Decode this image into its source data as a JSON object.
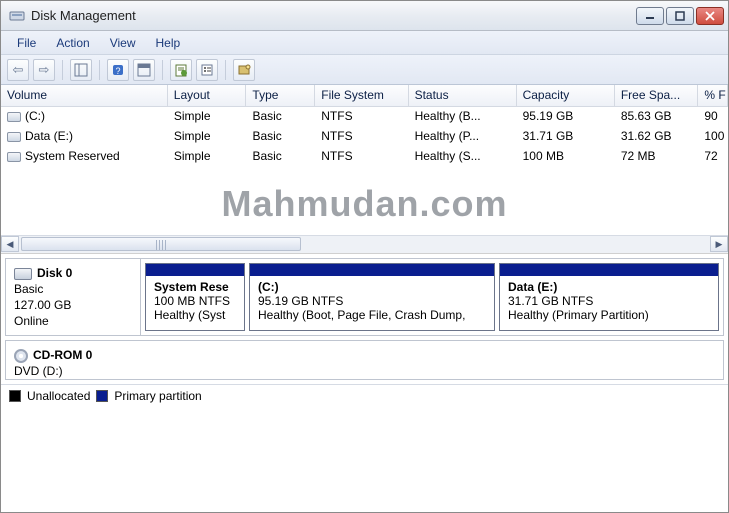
{
  "window": {
    "title": "Disk Management"
  },
  "menu": {
    "file": "File",
    "action": "Action",
    "view": "View",
    "help": "Help"
  },
  "columns": {
    "volume": "Volume",
    "layout": "Layout",
    "type": "Type",
    "fs": "File System",
    "status": "Status",
    "capacity": "Capacity",
    "free": "Free Spa...",
    "pct": "% F"
  },
  "volumes": [
    {
      "name": "(C:)",
      "layout": "Simple",
      "type": "Basic",
      "fs": "NTFS",
      "status": "Healthy (B...",
      "capacity": "95.19 GB",
      "free": "85.63 GB",
      "pct": "90"
    },
    {
      "name": "Data (E:)",
      "layout": "Simple",
      "type": "Basic",
      "fs": "NTFS",
      "status": "Healthy (P...",
      "capacity": "31.71 GB",
      "free": "31.62 GB",
      "pct": "100"
    },
    {
      "name": "System Reserved",
      "layout": "Simple",
      "type": "Basic",
      "fs": "NTFS",
      "status": "Healthy (S...",
      "capacity": "100 MB",
      "free": "72 MB",
      "pct": "72"
    }
  ],
  "watermark": "Mahmudan.com",
  "disk0": {
    "name": "Disk 0",
    "type": "Basic",
    "size": "127.00 GB",
    "state": "Online",
    "partitions": {
      "sr": {
        "name": "System Rese",
        "size": "100 MB NTFS",
        "status": "Healthy (Syst"
      },
      "c": {
        "name": "(C:)",
        "size": "95.19 GB NTFS",
        "status": "Healthy (Boot, Page File, Crash Dump,"
      },
      "e": {
        "name": "Data  (E:)",
        "size": "31.71 GB NTFS",
        "status": "Healthy (Primary Partition)"
      }
    }
  },
  "cdrom": {
    "name": "CD-ROM 0",
    "drive": "DVD (D:)"
  },
  "legend": {
    "unallocated": "Unallocated",
    "primary": "Primary partition"
  }
}
